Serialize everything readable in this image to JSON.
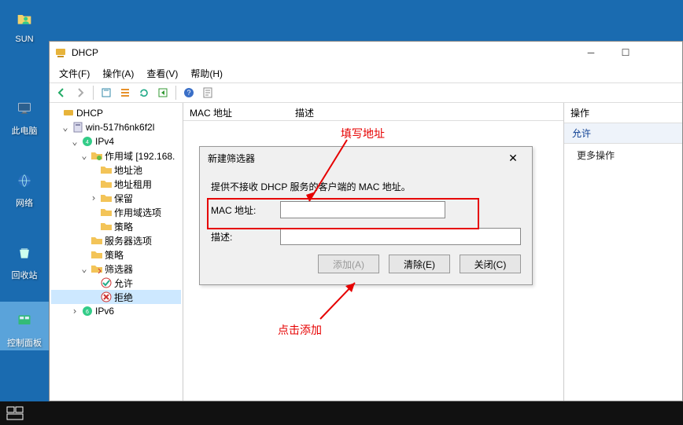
{
  "desktop": {
    "icons": [
      {
        "label": "SUN",
        "kind": "user"
      },
      {
        "label": "此电脑",
        "kind": "pc"
      },
      {
        "label": "网络",
        "kind": "network"
      },
      {
        "label": "回收站",
        "kind": "recycle"
      },
      {
        "label": "控制面板",
        "kind": "control-panel"
      }
    ]
  },
  "window": {
    "title": "DHCP",
    "menus": [
      "文件(F)",
      "操作(A)",
      "查看(V)",
      "帮助(H)"
    ]
  },
  "tree": {
    "nodes": [
      {
        "indent": 0,
        "tw": "",
        "icon": "dhcp",
        "label": "DHCP"
      },
      {
        "indent": 1,
        "tw": "v",
        "icon": "server",
        "label": "win-517h6nk6f2l"
      },
      {
        "indent": 2,
        "tw": "v",
        "icon": "ipv4",
        "label": "IPv4"
      },
      {
        "indent": 3,
        "tw": "v",
        "icon": "scope",
        "label": "作用域 [192.168."
      },
      {
        "indent": 4,
        "tw": "",
        "icon": "folder",
        "label": "地址池"
      },
      {
        "indent": 4,
        "tw": "",
        "icon": "folder",
        "label": "地址租用"
      },
      {
        "indent": 4,
        "tw": ">",
        "icon": "folder",
        "label": "保留"
      },
      {
        "indent": 4,
        "tw": "",
        "icon": "folder",
        "label": "作用域选项"
      },
      {
        "indent": 4,
        "tw": "",
        "icon": "folder",
        "label": "策略"
      },
      {
        "indent": 3,
        "tw": "",
        "icon": "folder",
        "label": "服务器选项"
      },
      {
        "indent": 3,
        "tw": "",
        "icon": "folder",
        "label": "策略"
      },
      {
        "indent": 3,
        "tw": "v",
        "icon": "filter",
        "label": "筛选器"
      },
      {
        "indent": 4,
        "tw": "",
        "icon": "allow",
        "label": "允许"
      },
      {
        "indent": 4,
        "tw": "",
        "icon": "deny",
        "label": "拒绝",
        "selected": true
      },
      {
        "indent": 2,
        "tw": ">",
        "icon": "ipv6",
        "label": "IPv6"
      }
    ]
  },
  "mid": {
    "columns": [
      "MAC 地址",
      "描述"
    ]
  },
  "actions": {
    "title": "操作",
    "selected": "允许",
    "item": "更多操作"
  },
  "dialog": {
    "title": "新建筛选器",
    "msg": "提供不接收 DHCP 服务的客户端的 MAC 地址。",
    "mac_label": "MAC 地址:",
    "mac_value": "",
    "desc_label": "描述:",
    "desc_value": "",
    "btn_add": "添加(A)",
    "btn_clear": "清除(E)",
    "btn_close": "关闭(C)"
  },
  "annotations": {
    "fill_address": "填写地址",
    "click_add": "点击添加"
  }
}
